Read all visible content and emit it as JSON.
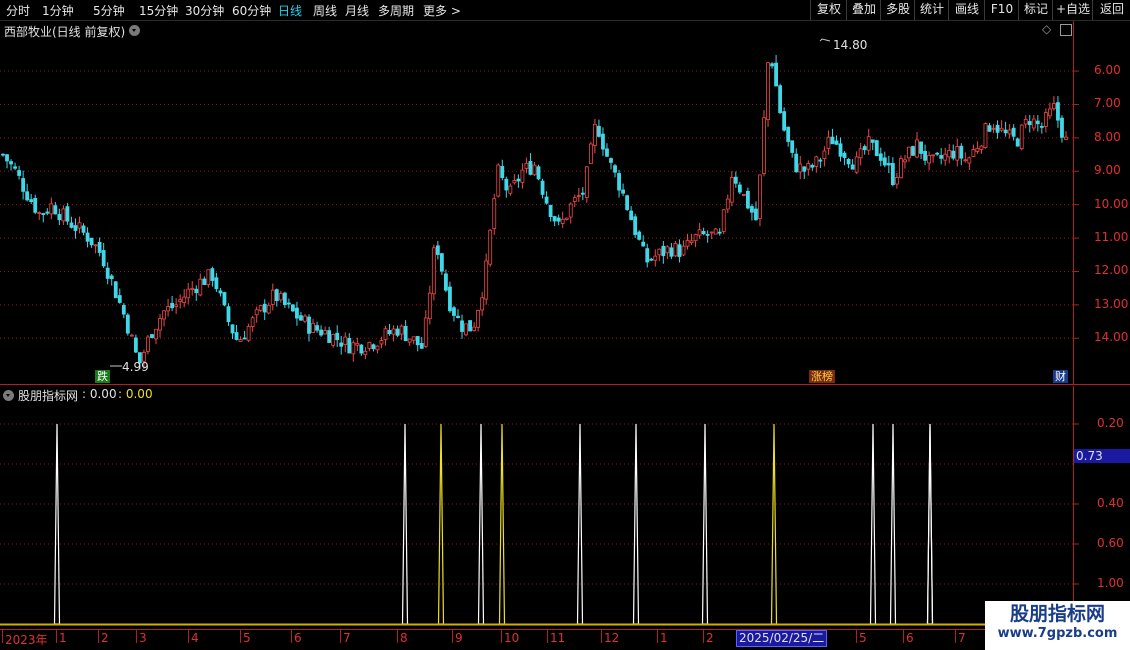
{
  "toolbar": {
    "periods": [
      "分时",
      "1分钟",
      "5分钟",
      "15分钟",
      "30分钟",
      "60分钟",
      "日线",
      "周线",
      "月线",
      "多周期",
      "更多"
    ],
    "active_period": "日线",
    "right_buttons": [
      "复权",
      "叠加",
      "多股",
      "统计",
      "画线",
      "F10",
      "标记",
      "+自选",
      "返回"
    ]
  },
  "main": {
    "title": "西部牧业(日线 前复权)",
    "high_label": "14.80",
    "low_label": "4.99",
    "badges": {
      "down": "跌",
      "limit_list": "涨榜",
      "finance": "财"
    },
    "y_ticks": [
      "14.00",
      "13.00",
      "12.00",
      "11.00",
      "10.00",
      "9.00",
      "8.00",
      "7.00",
      "6.00"
    ]
  },
  "indicator": {
    "title": "股朋指标网",
    "value_a": ": 0.00",
    "value_b": ": 0.00",
    "y_ticks": [
      "1.00",
      "0.60",
      "0.40",
      "0.20"
    ],
    "cursor_value": "0.73"
  },
  "date_axis": {
    "labels": [
      "2023年",
      "1",
      "2",
      "3",
      "4",
      "5",
      "6",
      "7",
      "8",
      "9",
      "10",
      "11",
      "12",
      "1",
      "2",
      "5",
      "6",
      "7"
    ],
    "cursor_date": "2025/02/25/二"
  },
  "watermark": {
    "line1": "股朋指标网",
    "line2": "www.7gpzb.com"
  },
  "colors": {
    "up": "#f04848",
    "down": "#40d8e8",
    "white_signal": "#ffffff",
    "yellow_signal": "#f0e020",
    "axis": "#e03030"
  },
  "chart_data": [
    {
      "type": "candlestick",
      "title": "西部牧业(日线 前复权)",
      "ylim": [
        5.2,
        14.9
      ],
      "y_ticks": [
        6,
        7,
        8,
        9,
        10,
        11,
        12,
        13,
        14
      ],
      "annotations": [
        {
          "label": "14.80",
          "value": 14.8
        },
        {
          "label": "4.99",
          "value": 4.99
        }
      ],
      "close_trend": [
        11.5,
        11.0,
        10.3,
        9.7,
        10.0,
        9.6,
        9.3,
        9.0,
        8.5,
        7.5,
        6.5,
        5.2,
        6.2,
        6.8,
        7.0,
        7.4,
        7.7,
        7.9,
        6.7,
        5.9,
        6.4,
        6.9,
        7.3,
        6.9,
        6.6,
        6.3,
        6.2,
        6.0,
        5.8,
        5.8,
        5.9,
        6.1,
        6.3,
        6.0,
        5.7,
        9.0,
        7.2,
        6.4,
        6.3,
        7.8,
        11.0,
        10.3,
        11.0,
        11.2,
        10.1,
        9.3,
        10.0,
        10.4,
        12.5,
        11.3,
        10.5,
        9.4,
        8.3,
        8.5,
        8.7,
        8.6,
        9.0,
        9.1,
        9.0,
        11.0,
        10.2,
        9.5,
        14.8,
        12.5,
        11.2,
        11.0,
        11.3,
        12.0,
        11.6,
        11.2,
        11.8,
        11.5,
        10.8,
        11.4,
        11.8,
        11.2,
        11.4,
        11.6,
        11.3,
        11.9,
        12.5,
        12.1,
        11.9,
        12.6,
        12.3,
        12.9,
        11.9
      ]
    },
    {
      "type": "bar",
      "title": "股朋指标网",
      "ylim": [
        0,
        1.1
      ],
      "y_ticks": [
        0.2,
        0.4,
        0.6,
        1.0
      ],
      "series": [
        {
          "name": "",
          "color": "white",
          "values": [
            1,
            1,
            1,
            1,
            1,
            1,
            1,
            1,
            1,
            1
          ]
        },
        {
          "name": "",
          "color": "yellow",
          "values": [
            1,
            1,
            1
          ]
        }
      ]
    }
  ]
}
